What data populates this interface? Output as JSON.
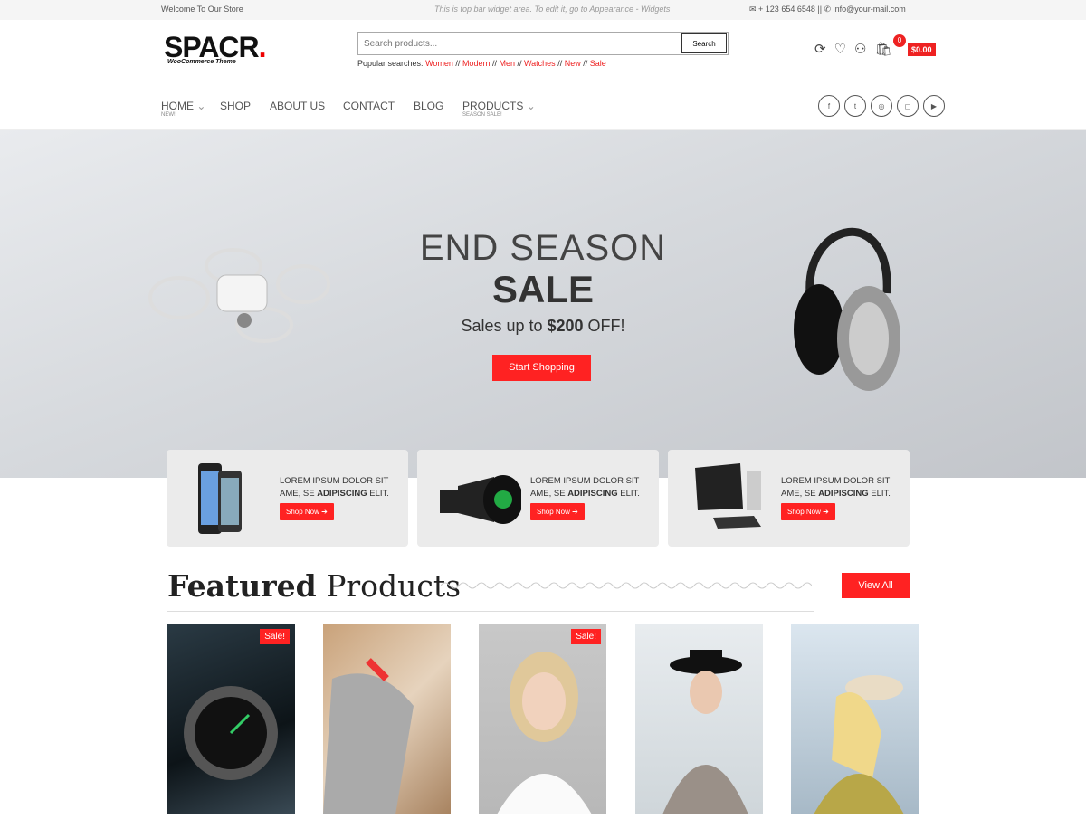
{
  "topbar": {
    "welcome": "Welcome To Our Store",
    "widget": "This is top bar widget area. To edit it, go to Appearance - Widgets",
    "phone": "✉ + 123 654 6548 || ✆ info@your-mail.com"
  },
  "header": {
    "logo": "SPACR",
    "logo_dot": ".",
    "logo_tagline": "WooCommerce Theme",
    "search_placeholder": "Search products...",
    "search_button": "Search",
    "popular_label": "Popular searches:",
    "popular": [
      "Women",
      "Modern",
      "Men",
      "Watches",
      "New",
      "Sale"
    ],
    "cart_count": "0",
    "cart_total": "$0.00"
  },
  "nav": {
    "items": [
      {
        "label": "HOME",
        "sub": "NEW!"
      },
      {
        "label": "SHOP"
      },
      {
        "label": "ABOUT US"
      },
      {
        "label": "CONTACT"
      },
      {
        "label": "BLOG"
      },
      {
        "label": "PRODUCTS",
        "sub": "SEASON SALE!"
      }
    ],
    "socials": [
      "f",
      "t",
      "◎",
      "◻",
      "▶"
    ]
  },
  "hero": {
    "line1": "END SEASON",
    "line2": "SALE",
    "line3_pre": "Sales up to ",
    "line3_amount": "$200",
    "line3_post": " OFF!",
    "button": "Start Shopping"
  },
  "promos": [
    {
      "text1": "LOREM IPSUM DOLOR SIT",
      "text2_pre": "AME, SE ",
      "text2_bold": "ADIPISCING",
      "text2_post": " ELIT.",
      "button": "Shop Now"
    },
    {
      "text1": "LOREM IPSUM DOLOR SIT",
      "text2_pre": "AME, SE ",
      "text2_bold": "ADIPISCING",
      "text2_post": " ELIT.",
      "button": "Shop Now"
    },
    {
      "text1": "LOREM IPSUM DOLOR SIT",
      "text2_pre": "AME, SE ",
      "text2_bold": "ADIPISCING",
      "text2_post": " ELIT.",
      "button": "Shop Now"
    }
  ],
  "featured": {
    "title_bold": "Featured",
    "title_rest": " Products",
    "view_all": "View All",
    "sale_badge": "Sale!"
  },
  "colors": {
    "accent": "#ff2222"
  }
}
